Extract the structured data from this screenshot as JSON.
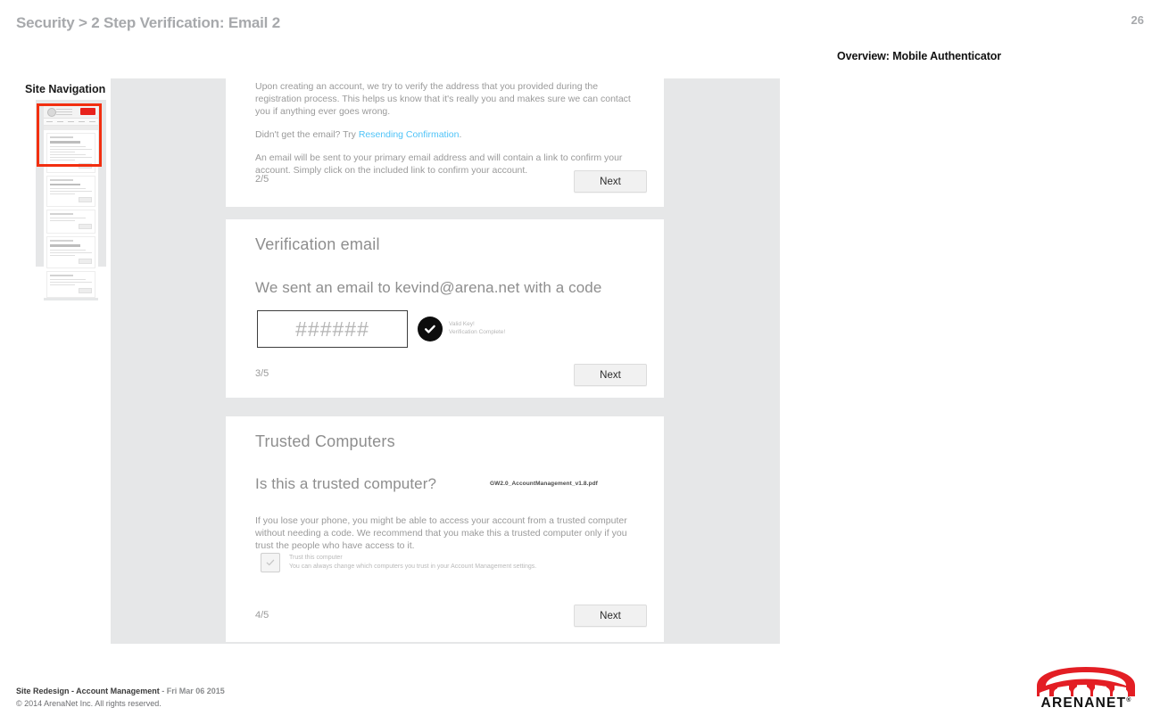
{
  "slide": {
    "title": "Security > 2 Step Verification: Email 2",
    "number": "26",
    "overview_label": "Overview: Mobile Authenticator"
  },
  "sidebar": {
    "label": "Site Navigation",
    "thumbnail_name": "page-thumbnail",
    "highlight_color": "#f22f10"
  },
  "cards": {
    "card1": {
      "paragraph1": "Upon creating an account, we try to verify the address that you provided during the registration process.  This helps us know that it's really you and makes sure we can contact you if anything ever goes wrong.",
      "paragraph2_prefix": "Didn't get the email? Try ",
      "paragraph2_link": "Resending Confirmation",
      "paragraph2_suffix": ".",
      "paragraph3": "An email will be sent to your primary email address and will contain a link to confirm your account. Simply click on the included link to confirm your account.",
      "step": "2/5",
      "next_label": "Next"
    },
    "card2": {
      "title": "Verification email",
      "subtitle": "We sent an email to kevind@arena.net with a code",
      "code_value": "######",
      "valid_line1": "Valid Key!",
      "valid_line2": "Verification Complete!",
      "step": "3/5",
      "next_label": "Next"
    },
    "card3": {
      "title": "Trusted Computers",
      "question": "Is this a trusted computer?",
      "filename": "GW2.0_AccountManagement_v1.8.pdf",
      "paragraph": "If you lose your phone, you might be able to access your account from a trusted computer without needing a code.  We recommend that you make this a trusted computer only if you trust the people who have access to it.",
      "checkbox_label": "Trust this computer",
      "checkbox_sublabel": "You can always change which computers you trust in your Account Management settings.",
      "step": "4/5",
      "next_label": "Next"
    }
  },
  "footer": {
    "project": "Site Redesign - Account Management",
    "separator": " - ",
    "date": "Fri Mar 06 2015",
    "copyright": "© 2014 ArenaNet Inc. All rights reserved."
  },
  "logo": {
    "wordmark": "ARENANET",
    "registered": "®",
    "color": "#e31e24"
  }
}
